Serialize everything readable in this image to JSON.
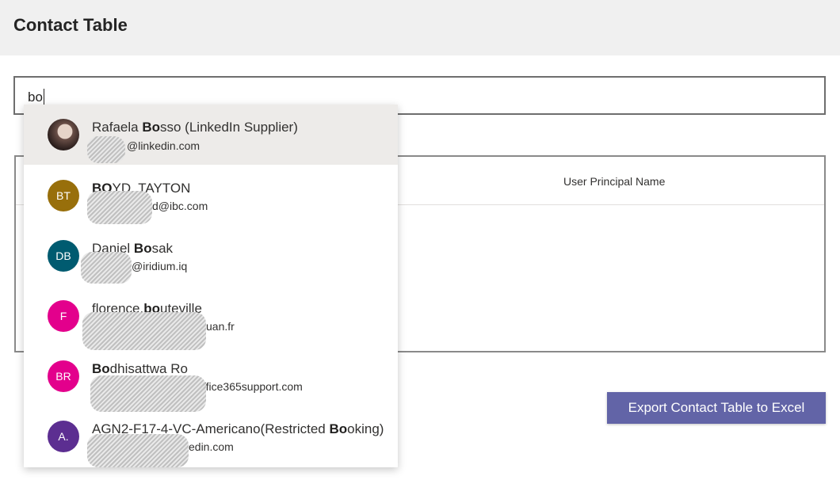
{
  "header": {
    "title": "Contact Table"
  },
  "search": {
    "value": "bo"
  },
  "table": {
    "column_upn": "User Principal Name"
  },
  "export_button": {
    "label": "Export Contact Table to Excel"
  },
  "suggestions": [
    {
      "avatar": "",
      "avatar_type": "photo",
      "color": "#000000",
      "name_pre": "Rafaela ",
      "name_match": "Bo",
      "name_post": "sso (LinkedIn Supplier)",
      "email": "@linkedin.com",
      "selected": true
    },
    {
      "avatar": "BT",
      "color": "#986f0b",
      "name_pre": "",
      "name_match": "BO",
      "name_post": "YD, TAYTON",
      "email": "d@ibc.com"
    },
    {
      "avatar": "DB",
      "color": "#005b70",
      "name_pre": "Daniel ",
      "name_match": "Bo",
      "name_post": "sak",
      "email": "@iridium.iq"
    },
    {
      "avatar": "F",
      "color": "#e3008c",
      "name_pre": "florence.",
      "name_match": "bo",
      "name_post": "uteville",
      "email": "uan.fr"
    },
    {
      "avatar": "BR",
      "color": "#e3008c",
      "name_pre": "",
      "name_match": "Bo",
      "name_post": "dhisattwa Ro",
      "email": "ffice365support.com"
    },
    {
      "avatar": "A.",
      "color": "#5c2e91",
      "name_pre": "AGN2-F17-4-VC-Americano(Restricted ",
      "name_match": "Bo",
      "name_post": "oking)",
      "email": "edin.com"
    }
  ]
}
